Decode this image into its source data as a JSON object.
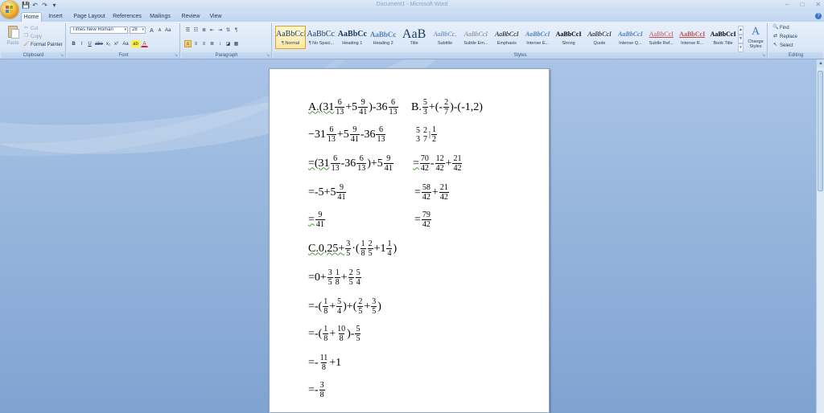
{
  "titlebar": {
    "title": "Document1 - Microsoft Word",
    "window_controls": [
      "–",
      "□",
      "✕"
    ]
  },
  "quick_access": {
    "save_icon": "💾",
    "undo_icon": "↶",
    "redo_icon": "↷",
    "customize": "▾"
  },
  "tabs": [
    "Home",
    "Insert",
    "Page Layout",
    "References",
    "Mailings",
    "Review",
    "View"
  ],
  "active_tab": "Home",
  "ribbon": {
    "clipboard": {
      "label": "Clipboard",
      "paste": "Paste",
      "cut": "Cut",
      "copy": "Copy",
      "format_painter": "Format Painter"
    },
    "font": {
      "label": "Font",
      "font_name": "Times New Roman",
      "font_size": "28",
      "grow": "A",
      "shrink": "A",
      "clear": "Aa",
      "bold": "B",
      "italic": "I",
      "underline": "U",
      "strike": "abe",
      "subscript": "x₂",
      "superscript": "x²",
      "change_case": "Aa",
      "highlight": "ab",
      "font_color": "A"
    },
    "paragraph": {
      "label": "Paragraph"
    },
    "styles": {
      "label": "Styles",
      "items": [
        {
          "sample": "AaBbCcI",
          "name": "¶ Normal"
        },
        {
          "sample": "AaBbCcI",
          "name": "¶ No Spaci..."
        },
        {
          "sample": "AaBbCc",
          "name": "Heading 1"
        },
        {
          "sample": "AaBbCc",
          "name": "Heading 2"
        },
        {
          "sample": "AaB",
          "name": "Title"
        },
        {
          "sample": "AaBbCc.",
          "name": "Subtitle"
        },
        {
          "sample": "AaBbCcI",
          "name": "Subtle Em..."
        },
        {
          "sample": "AaBbCcI",
          "name": "Emphasis"
        },
        {
          "sample": "AaBbCcI",
          "name": "Intense E..."
        },
        {
          "sample": "AaBbCcI",
          "name": "Strong"
        },
        {
          "sample": "AaBbCcI",
          "name": "Quote"
        },
        {
          "sample": "AaBbCcI",
          "name": "Intense Q..."
        },
        {
          "sample": "AaBbCcI",
          "name": "Subtle Ref..."
        },
        {
          "sample": "AaBbCcI",
          "name": "Intense R..."
        },
        {
          "sample": "AaBbCcI",
          "name": "Book Title"
        }
      ],
      "change_styles": "Change Styles"
    },
    "editing": {
      "label": "Editing",
      "find": "Find",
      "replace": "Replace",
      "select": "Select"
    }
  },
  "document": {
    "A_header": "A.(31",
    "A_f1": [
      "6",
      "13"
    ],
    "A_plus5": "+5",
    "A_f2": [
      "9",
      "41"
    ],
    "A_minus36": ")-36",
    "A_f3": [
      "6",
      "13"
    ],
    "A_l2_a": "−31",
    "A_l2_f1": [
      "6",
      "13"
    ],
    "A_l2_b": "+5",
    "A_l2_f2": [
      "9",
      "41"
    ],
    "A_l2_c": "-36",
    "A_l2_f3": [
      "6",
      "13"
    ],
    "A_l3_a": "=(31",
    "A_l3_f1": [
      "6",
      "13"
    ],
    "A_l3_b": "-36",
    "A_l3_f2": [
      "6",
      "13"
    ],
    "A_l3_c": ")+5",
    "A_l3_f3": [
      "9",
      "41"
    ],
    "A_l4_a": "=-5+5",
    "A_l4_f1": [
      "9",
      "41"
    ],
    "A_l5_a": "=",
    "A_l5_f1": [
      "9",
      "41"
    ],
    "B_header": "B.",
    "B_f1": [
      "5",
      "3"
    ],
    "B_b": "+(-",
    "B_f2": [
      "2",
      "7"
    ],
    "B_c": ")-(-1,2)",
    "B_l2_f1": [
      "5",
      "3 "
    ],
    "B_l2_f2": [
      "2",
      "7"
    ],
    "B_l2_sep": "|",
    "B_l2_f3": [
      "1",
      "2"
    ],
    "B_l3_a": "=",
    "B_l3_f1": [
      "70",
      "42"
    ],
    "B_l3_b": "-",
    "B_l3_f2": [
      "12",
      "42"
    ],
    "B_l3_c": "+",
    "B_l3_f3": [
      "21",
      "42"
    ],
    "B_l4_a": "=",
    "B_l4_f1": [
      "58",
      "42"
    ],
    "B_l4_b": "+",
    "B_l4_f2": [
      "21",
      "42"
    ],
    "B_l5_a": "=",
    "B_l5_f1": [
      "79",
      "42"
    ],
    "C_header": "C.0,25+",
    "C_f1": [
      "3",
      "5"
    ],
    "C_b": "·(",
    "C_f2": [
      "1",
      "8"
    ],
    "C_f3": [
      "2",
      "5"
    ],
    "C_c": "+1",
    "C_f4": [
      "1",
      "4"
    ],
    "C_d": ")",
    "C_l2_a": "=0+",
    "C_l2_f1": [
      "3",
      "5"
    ],
    "C_l2_f2": [
      "1",
      "8"
    ],
    "C_l2_b": "+",
    "C_l2_f3": [
      "2",
      "5"
    ],
    "C_l2_f4": [
      "5",
      "4"
    ],
    "C_l3_a": "=-(",
    "C_l3_f1": [
      "1",
      "8"
    ],
    "C_l3_b": "+",
    "C_l3_f2": [
      "5",
      "4"
    ],
    "C_l3_c": ")+(",
    "C_l3_f3": [
      "2",
      "5"
    ],
    "C_l3_d": "+",
    "C_l3_f4": [
      "3",
      "5"
    ],
    "C_l3_e": ")",
    "C_l4_a": "=-(",
    "C_l4_f1": [
      "1",
      "8"
    ],
    "C_l4_b": "+",
    "C_l4_f2": [
      "10",
      "8"
    ],
    "C_l4_c": ")-",
    "C_l4_f3": [
      "5",
      "5"
    ],
    "C_l5_a": "=-",
    "C_l5_f1": [
      "11",
      "8"
    ],
    "C_l5_b": "+1",
    "C_l6_a": "=-",
    "C_l6_f1": [
      "3",
      "8"
    ]
  }
}
